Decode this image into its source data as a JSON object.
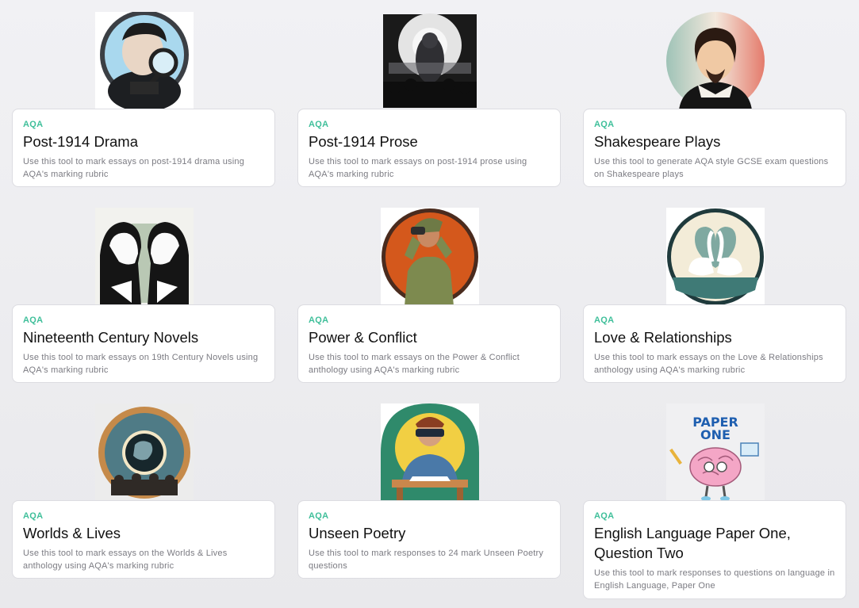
{
  "tools": [
    {
      "tag": "AQA",
      "title": "Post-1914 Drama",
      "desc": "Use this tool to mark essays on post-1914 drama using AQA's marking rubric",
      "icon": "detective-magnifier-icon"
    },
    {
      "tag": "AQA",
      "title": "Post-1914 Prose",
      "desc": "Use this tool to mark essays on post-1914 prose using AQA's marking rubric",
      "icon": "pig-speech-crowd-icon"
    },
    {
      "tag": "AQA",
      "title": "Shakespeare Plays",
      "desc": "Use this tool to generate AQA style GCSE exam questions on Shakespeare plays",
      "icon": "shakespeare-portrait-icon"
    },
    {
      "tag": "AQA",
      "title": "Nineteenth Century Novels",
      "desc": "Use this tool to mark essays on 19th Century Novels using AQA's marking rubric",
      "icon": "two-gentlemen-book-icon"
    },
    {
      "tag": "AQA",
      "title": "Power & Conflict",
      "desc": "Use this tool to mark essays on the Power & Conflict anthology using AQA's marking rubric",
      "icon": "soldier-binoculars-icon"
    },
    {
      "tag": "AQA",
      "title": "Love & Relationships",
      "desc": "Use this tool to mark essays on the Love & Relationships anthology using AQA's marking rubric",
      "icon": "swans-heart-icon"
    },
    {
      "tag": "AQA",
      "title": "Worlds & Lives",
      "desc": "Use this tool to mark essays on the Worlds & Lives anthology using AQA's marking rubric",
      "icon": "globe-crowd-icon"
    },
    {
      "tag": "AQA",
      "title": "Unseen Poetry",
      "desc": "Use this tool to mark responses to 24 mark Unseen Poetry questions",
      "icon": "blindfolded-writer-icon"
    },
    {
      "tag": "AQA",
      "title": "English Language Paper One, Question Two",
      "desc": "Use this tool to mark responses to questions on language in English Language, Paper One",
      "icon": "brain-mascot-icon",
      "art_text": "PAPER ONE"
    }
  ]
}
